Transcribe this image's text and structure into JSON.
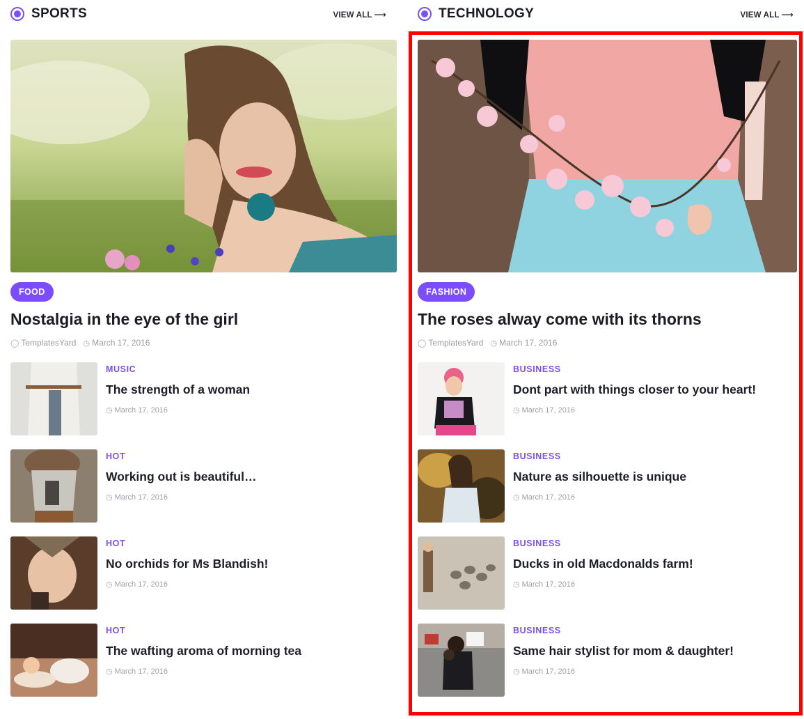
{
  "sections": [
    {
      "title": "SPORTS",
      "view_all": "VIEW ALL",
      "feature": {
        "category": "FOOD",
        "title": "Nostalgia in the eye of the girl",
        "author": "TemplatesYard",
        "date": "March 17, 2016"
      },
      "items": [
        {
          "category": "MUSIC",
          "title": "The strength of a woman",
          "date": "March 17, 2016"
        },
        {
          "category": "HOT",
          "title": "Working out is beautiful…",
          "date": "March 17, 2016"
        },
        {
          "category": "HOT",
          "title": "No orchids for Ms Blandish!",
          "date": "March 17, 2016"
        },
        {
          "category": "HOT",
          "title": "The wafting aroma of morning tea",
          "date": "March 17, 2016"
        }
      ]
    },
    {
      "title": "TECHNOLOGY",
      "view_all": "VIEW ALL",
      "feature": {
        "category": "FASHION",
        "title": "The roses alway come with its thorns",
        "author": "TemplatesYard",
        "date": "March 17, 2016"
      },
      "items": [
        {
          "category": "BUSINESS",
          "title": "Dont part with things closer to your heart!",
          "date": "March 17, 2016"
        },
        {
          "category": "BUSINESS",
          "title": "Nature as silhouette is unique",
          "date": "March 17, 2016"
        },
        {
          "category": "BUSINESS",
          "title": "Ducks in old Macdonalds farm!",
          "date": "March 17, 2016"
        },
        {
          "category": "BUSINESS",
          "title": "Same hair stylist for mom & daughter!",
          "date": "March 17, 2016"
        }
      ]
    }
  ],
  "icons": {
    "section_marker": "radio-dot-icon",
    "view_all": "arrow-right-icon",
    "author": "user-icon",
    "date": "clock-icon"
  },
  "colors": {
    "accent": "#7c4dff",
    "highlight": "#ff0000",
    "title": "#1b1b26",
    "meta": "#9b9ba5"
  }
}
